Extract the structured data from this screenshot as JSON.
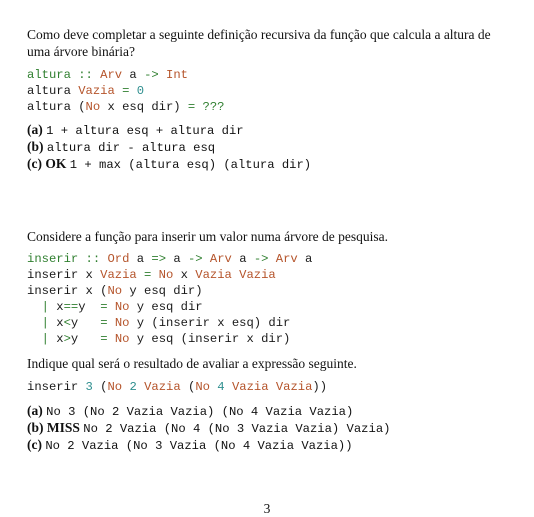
{
  "q1": {
    "prompt": "Como deve completar a seguinte definição recursiva da função que calcula a altura de uma árvore binária?",
    "code": [
      {
        "parts": [
          {
            "t": "altura ",
            "c": "kw"
          },
          {
            "t": ":: ",
            "c": "op"
          },
          {
            "t": "Arv",
            "c": "ty"
          },
          {
            "t": " a ",
            "c": "fn"
          },
          {
            "t": "->",
            "c": "op"
          },
          {
            "t": " Int",
            "c": "ty"
          }
        ]
      },
      {
        "parts": [
          {
            "t": "altura ",
            "c": "fn"
          },
          {
            "t": "Vazia",
            "c": "ty"
          },
          {
            "t": " = ",
            "c": "op"
          },
          {
            "t": "0",
            "c": "num"
          }
        ]
      },
      {
        "parts": [
          {
            "t": "altura (",
            "c": "fn"
          },
          {
            "t": "No",
            "c": "ty"
          },
          {
            "t": " x esq dir) ",
            "c": "fn"
          },
          {
            "t": "= ???",
            "c": "op"
          }
        ]
      }
    ],
    "options": [
      {
        "label": "(a)",
        "tag": "",
        "code": "1 + altura esq + altura dir"
      },
      {
        "label": "(b)",
        "tag": "",
        "code": "altura dir - altura esq"
      },
      {
        "label": "(c)",
        "tag": "OK",
        "code": "1 + max (altura esq) (altura dir)"
      }
    ]
  },
  "q2": {
    "prompt": "Considere a função para inserir um valor numa árvore de pesquisa.",
    "code": [
      {
        "parts": [
          {
            "t": "inserir ",
            "c": "kw"
          },
          {
            "t": ":: ",
            "c": "op"
          },
          {
            "t": "Ord",
            "c": "ty"
          },
          {
            "t": " a ",
            "c": "fn"
          },
          {
            "t": "=>",
            "c": "op"
          },
          {
            "t": " a ",
            "c": "fn"
          },
          {
            "t": "->",
            "c": "op"
          },
          {
            "t": " Arv",
            "c": "ty"
          },
          {
            "t": " a ",
            "c": "fn"
          },
          {
            "t": "->",
            "c": "op"
          },
          {
            "t": " Arv",
            "c": "ty"
          },
          {
            "t": " a",
            "c": "fn"
          }
        ]
      },
      {
        "parts": [
          {
            "t": "inserir x ",
            "c": "fn"
          },
          {
            "t": "Vazia",
            "c": "ty"
          },
          {
            "t": " = ",
            "c": "op"
          },
          {
            "t": "No",
            "c": "ty"
          },
          {
            "t": " x ",
            "c": "fn"
          },
          {
            "t": "Vazia Vazia",
            "c": "ty"
          }
        ]
      },
      {
        "parts": [
          {
            "t": "inserir x (",
            "c": "fn"
          },
          {
            "t": "No",
            "c": "ty"
          },
          {
            "t": " y esq dir)",
            "c": "fn"
          }
        ]
      },
      {
        "parts": [
          {
            "t": "  | ",
            "c": "op"
          },
          {
            "t": "x",
            "c": "fn"
          },
          {
            "t": "==",
            "c": "op"
          },
          {
            "t": "y  ",
            "c": "fn"
          },
          {
            "t": "= ",
            "c": "op"
          },
          {
            "t": "No",
            "c": "ty"
          },
          {
            "t": " y esq dir",
            "c": "fn"
          }
        ]
      },
      {
        "parts": [
          {
            "t": "  | ",
            "c": "op"
          },
          {
            "t": "x",
            "c": "fn"
          },
          {
            "t": "<",
            "c": "op"
          },
          {
            "t": "y   ",
            "c": "fn"
          },
          {
            "t": "= ",
            "c": "op"
          },
          {
            "t": "No",
            "c": "ty"
          },
          {
            "t": " y (inserir x esq) dir",
            "c": "fn"
          }
        ]
      },
      {
        "parts": [
          {
            "t": "  | ",
            "c": "op"
          },
          {
            "t": "x",
            "c": "fn"
          },
          {
            "t": ">",
            "c": "op"
          },
          {
            "t": "y   ",
            "c": "fn"
          },
          {
            "t": "= ",
            "c": "op"
          },
          {
            "t": "No",
            "c": "ty"
          },
          {
            "t": " y esq (inserir x dir)",
            "c": "fn"
          }
        ]
      }
    ],
    "instruction": "Indique qual será o resultado de avaliar a expressão seguinte.",
    "expr": [
      {
        "parts": [
          {
            "t": "inserir ",
            "c": "fn"
          },
          {
            "t": "3",
            "c": "num"
          },
          {
            "t": " (",
            "c": "fn"
          },
          {
            "t": "No",
            "c": "ty"
          },
          {
            "t": " ",
            "c": "fn"
          },
          {
            "t": "2",
            "c": "num"
          },
          {
            "t": " ",
            "c": "fn"
          },
          {
            "t": "Vazia",
            "c": "ty"
          },
          {
            "t": " (",
            "c": "fn"
          },
          {
            "t": "No",
            "c": "ty"
          },
          {
            "t": " ",
            "c": "fn"
          },
          {
            "t": "4",
            "c": "num"
          },
          {
            "t": " ",
            "c": "fn"
          },
          {
            "t": "Vazia Vazia",
            "c": "ty"
          },
          {
            "t": "))",
            "c": "fn"
          }
        ]
      }
    ],
    "options": [
      {
        "label": "(a)",
        "tag": "",
        "code": "No 3 (No 2 Vazia Vazia) (No 4 Vazia Vazia)"
      },
      {
        "label": "(b)",
        "tag": "MISS",
        "code": "No 2 Vazia (No 4 (No 3 Vazia Vazia) Vazia)"
      },
      {
        "label": "(c)",
        "tag": "",
        "code": "No 2 Vazia (No 3 Vazia (No 4 Vazia Vazia))"
      }
    ]
  },
  "page_number": "3"
}
